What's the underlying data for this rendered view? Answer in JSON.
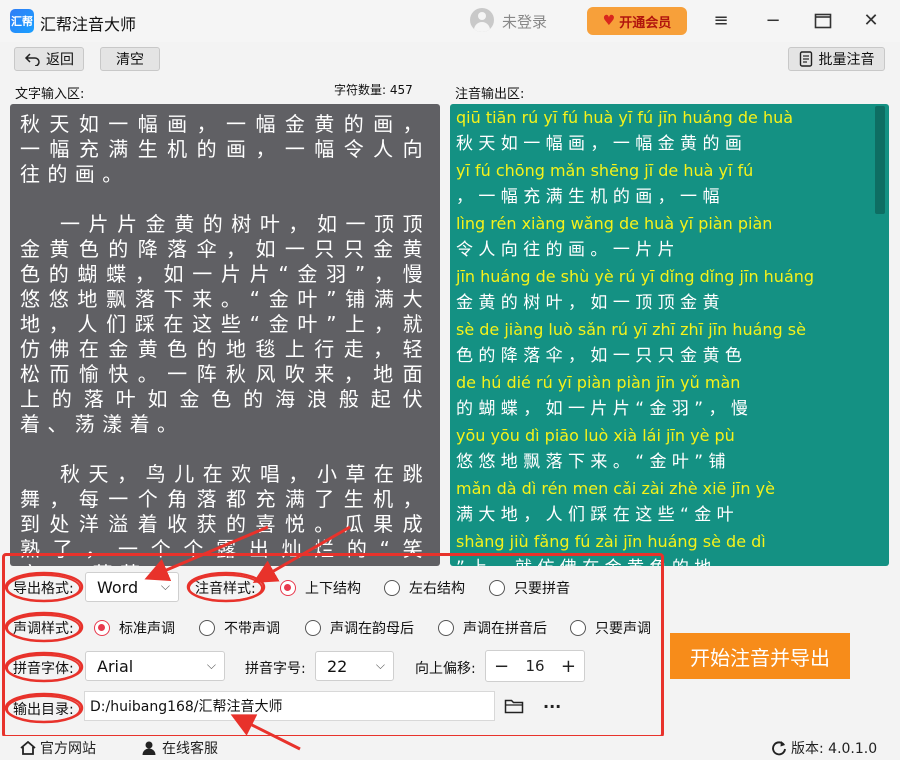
{
  "app": {
    "title": "汇帮注音大师",
    "logo_text": "汇帮",
    "login_text": "未登录",
    "vip_label": "开通会员"
  },
  "toolbar": {
    "back_label": "返回",
    "clear_label": "清空",
    "batch_label": "批量注音"
  },
  "input": {
    "area_label": "文字输入区:",
    "count_label": "字符数量: 457",
    "paragraphs": [
      "秋天如一幅画，一幅金黄的画，一幅充满生机的画，一幅令人向往的画。",
      "一片片金黄的树叶，如一顶顶金黄色的降落伞，如一只只金黄色的蝴蝶，如一片片“金羽”，慢悠悠地飘落下来。“金叶”铺满大地，人们踩在这些“金叶”上，就仿佛在金黄色的地毯上行走，轻松而愉快。一阵秋风吹来，地面上的落叶如金色的海浪般起伏着、荡漾着。",
      "秋天，鸟儿在欢唱，小草在跳舞，每一个角落都充满了生机，到处洋溢着收获的喜悦。瓜果成熟了，一个个露出灿烂的“笑容”，葡萄"
    ]
  },
  "output": {
    "area_label": "注音输出区:",
    "lines": [
      {
        "pinyin": "qiū tiān rú yī fú huà     yī fú jīn huáng de huà",
        "hanzi": "秋  天  如  一  幅  画  ，  一  幅  金   黄   的  画"
      },
      {
        "pinyin": "   yī  fú  chōng  mǎn  shēng  jī  de  huà     yī  fú",
        "hanzi": "，  一  幅  充    满   生   机  的  画  ，  一  幅"
      },
      {
        "pinyin": "lìng rén xiàng wǎng de huà              yī piàn piàn",
        "hanzi": "令  人   向   往   的  画  。        一  片   片"
      },
      {
        "pinyin": "jīn huáng de shù yè     rú yī dǐng dǐng jīn huáng",
        "hanzi": "金   黄   的  树  叶  ，  如  一  顶   顶   金   黄"
      },
      {
        "pinyin": "sè de jiàng luò sǎn     rú yī zhī zhī jīn huáng sè",
        "hanzi": "色  的  降   落  伞  ，  如  一  只  只  金   黄   色"
      },
      {
        "pinyin": "de hú dié     rú yī piàn piàn     jīn yǔ         màn",
        "hanzi": "的  蝴  蝶  ，  如  一  片   片  “  金  羽  ”  ，  慢"
      },
      {
        "pinyin": "yōu yōu dì piāo luò xià lái          jīn yè      pù",
        "hanzi": "悠  悠  地  飘  落  下  来  。  “  金  叶  ”  铺"
      },
      {
        "pinyin": "mǎn dà dì      rén men cǎi zài zhè xiē      jīn yè",
        "hanzi": "满  大  地  ，  人  们  踩  在  这  些  “  金  叶"
      },
      {
        "pinyin": "  shàng      jiù fǎng fú zài jīn huáng sè de dì",
        "hanzi": "”  上  ，  就  仿  佛  在  金   黄   色  的  地"
      }
    ]
  },
  "settings": {
    "export_format_label": "导出格式:",
    "export_format_value": "Word",
    "annotation_style_label": "注音样式:",
    "annotation_options": [
      {
        "label": "上下结构",
        "selected": true
      },
      {
        "label": "左右结构",
        "selected": false
      },
      {
        "label": "只要拼音",
        "selected": false
      }
    ],
    "tone_style_label": "声调样式:",
    "tone_options": [
      {
        "label": "标准声调",
        "selected": true
      },
      {
        "label": "不带声调",
        "selected": false
      },
      {
        "label": "声调在韵母后",
        "selected": false
      },
      {
        "label": "声调在拼音后",
        "selected": false
      },
      {
        "label": "只要声调",
        "selected": false
      }
    ],
    "pinyin_font_label": "拼音字体:",
    "pinyin_font_value": "Arial",
    "pinyin_size_label": "拼音字号:",
    "pinyin_size_value": "22",
    "offset_label": "向上偏移:",
    "offset_value": "16",
    "minus": "−",
    "plus": "+",
    "output_dir_label": "输出目录:",
    "output_dir_value": "D:/huibang168/汇帮注音大师",
    "more": "···"
  },
  "start_button": "开始注音并导出",
  "footer": {
    "website": "官方网站",
    "support": "在线客服",
    "version": "版本: 4.0.1.0"
  },
  "colors": {
    "accent": "#f78c1a",
    "highlight": "#e8322b",
    "output_bg": "#149183",
    "input_bg": "#606064",
    "pinyin": "#f6f21a"
  },
  "icons": [
    "back-arrow-icon",
    "batch-doc-icon",
    "folder-icon",
    "home-icon",
    "user-service-icon",
    "refresh-icon",
    "heart-vip-icon"
  ]
}
